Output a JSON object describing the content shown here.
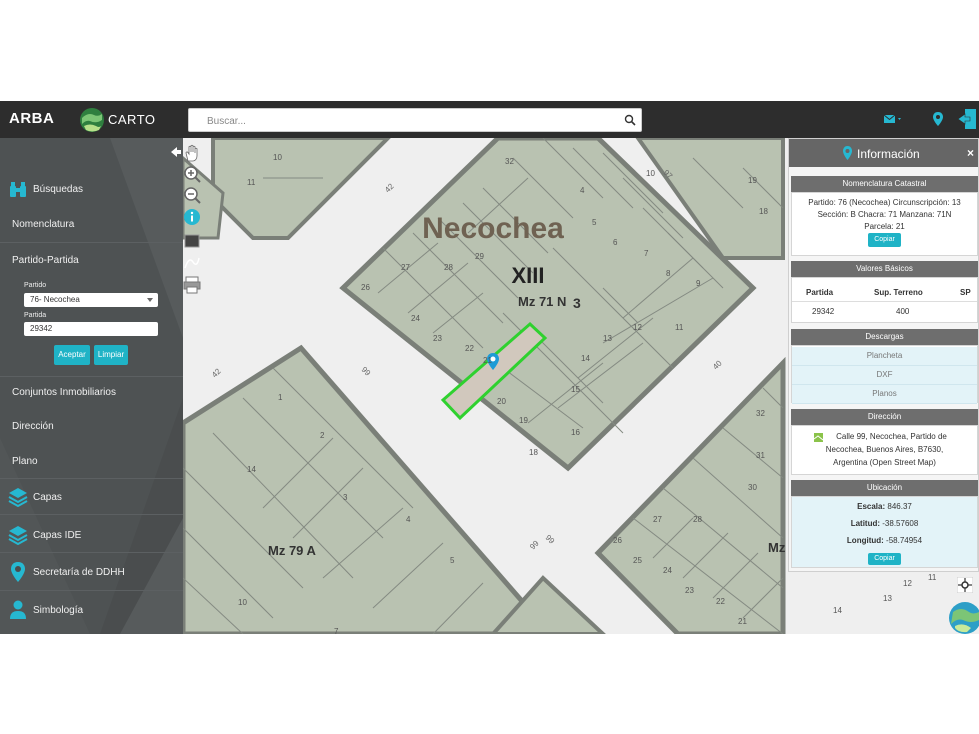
{
  "topbar": {
    "brand": "ARBA",
    "carto": "CARTO",
    "search_placeholder": "Buscar..."
  },
  "sidebar": {
    "busquedas": "Búsquedas",
    "nomenclatura": "Nomenclatura",
    "partido_partida": "Partido-Partida",
    "partido_label": "Partido",
    "partido_value": "76- Necochea",
    "partida_label": "Partida",
    "partida_value": "29342",
    "aceptar": "Aceptar",
    "limpiar": "Limpiar",
    "conjuntos": "Conjuntos Inmobiliarios",
    "direccion": "Dirección",
    "plano": "Plano",
    "capas": "Capas",
    "capas_ide": "Capas IDE",
    "secretaria": "Secretaría de DDHH",
    "simbologia": "Simbología"
  },
  "map": {
    "city": "Necochea",
    "roman": "XIII",
    "mz71": "Mz 71 N",
    "mz71_suffix": "3",
    "mz79": "Mz 79 A",
    "mz_right": "Mz",
    "streets": {
      "s42a": "42",
      "s42b": "42",
      "s99a": "99",
      "s99b": "99",
      "s99c": "99",
      "s40a": "40",
      "s40b": "40",
      "s97": "97"
    },
    "block_top_left": [
      "10",
      "11"
    ],
    "block_center": [
      "32",
      "4",
      "5",
      "6",
      "7",
      "8",
      "9",
      "10",
      "11",
      "12",
      "13",
      "14",
      "15",
      "16",
      "18",
      "19",
      "20",
      "21",
      "22",
      "23",
      "24",
      "26",
      "27",
      "28",
      "29"
    ],
    "block_bottom_left": [
      "1",
      "2",
      "3",
      "4",
      "5",
      "14",
      "10",
      "7"
    ],
    "block_right": [
      "19",
      "18",
      "32",
      "31",
      "30",
      "26",
      "25",
      "24",
      "23",
      "22",
      "21",
      "27",
      "28",
      "14",
      "13",
      "12",
      "11"
    ]
  },
  "info": {
    "title": "Información",
    "nomenclatura_head": "Nomenclatura Catastral",
    "nom_line1": "Partido: 76 (Necochea) Circunscripción: 13",
    "nom_line2": "Sección: B Chacra: 71 Manzana: 71N",
    "nom_line3": "Parcela: 21",
    "copy1": "Copiar",
    "valores_head": "Valores Básicos",
    "col_partida": "Partida",
    "col_sup": "Sup. Terreno",
    "col_sp": "SP",
    "val_partida": "29342",
    "val_sup": "400",
    "descargas_head": "Descargas",
    "plancheta": "Plancheta",
    "dxf": "DXF",
    "planos": "Planos",
    "direccion_head": "Dirección",
    "dir_line1": "Calle 99, Necochea, Partido de",
    "dir_line2": "Necochea, Buenos Aires, B7630,",
    "dir_line3": "Argentina (Open Street Map)",
    "ubicacion_head": "Ubicación",
    "escala_label": "Escala:",
    "escala_val": "846.37",
    "latitud_label": "Latitud:",
    "latitud_val": "-38.57608",
    "longitud_label": "Longitud:",
    "longitud_val": "-58.74954",
    "copy2": "Copiar"
  }
}
